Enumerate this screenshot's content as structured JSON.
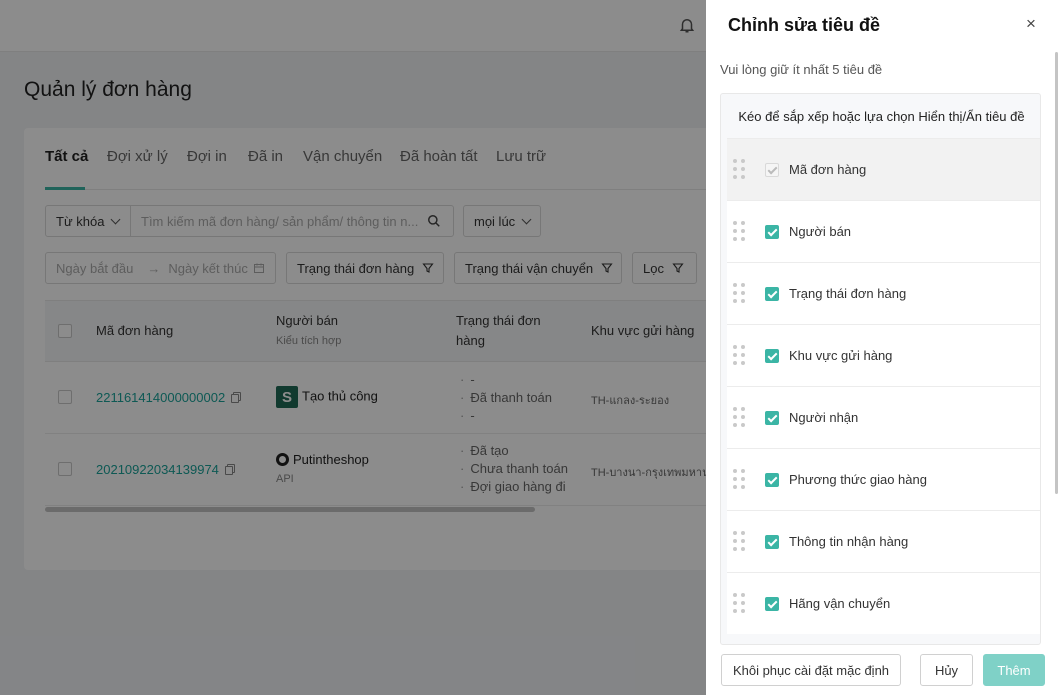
{
  "page": {
    "title": "Quản lý đơn hàng",
    "tabs": [
      "Tất cả",
      "Đợi xử lý",
      "Đợi in",
      "Đã in",
      "Vận chuyển",
      "Đã hoàn tất",
      "Lưu trữ"
    ],
    "active_tab": "Tất cả",
    "filters": {
      "keyword_select": "Từ khóa",
      "search_placeholder": "Tìm kiếm mã đơn hàng/ sản phẩm/ thông tin n...",
      "time_select": "mọi lúc",
      "start_date_placeholder": "Ngày bắt đầu",
      "arrow": "→",
      "end_date_placeholder": "Ngày kết thúc",
      "order_status": "Trạng thái đơn hàng",
      "shipping_status": "Trạng thái vận chuyển",
      "filter": "Lọc"
    },
    "table": {
      "headers": {
        "order_id": "Mã đơn hàng",
        "seller": "Người bán",
        "seller_sub": "Kiểu tích hợp",
        "order_status_l1": "Trạng thái đơn",
        "order_status_l2": "hàng",
        "region": "Khu vực gửi hàng"
      },
      "rows": [
        {
          "order_id": "221161414000000002",
          "seller_badge": "S",
          "seller": "Tạo thủ công",
          "seller_sub": "",
          "statuses": [
            "-",
            "Đã thanh toán",
            "-"
          ],
          "region": "TH-แกลง-ระยอง"
        },
        {
          "order_id": "20210922034139974",
          "seller_badge": "",
          "seller": "Putintheshop",
          "seller_sub": "API",
          "statuses": [
            "Đã tạo",
            "Chưa thanh toán",
            "Đợi giao hàng đi"
          ],
          "region": "TH-บางนา-กรุงเทพมหานคร"
        }
      ]
    }
  },
  "drawer": {
    "title": "Chỉnh sửa tiêu đề",
    "hint": "Vui lòng giữ ít nhất 5 tiêu đề",
    "panel_header": "Kéo để sắp xếp hoặc lựa chọn Hiển thị/Ẩn tiêu đề",
    "columns": [
      {
        "label": "Mã đơn hàng",
        "checked": true,
        "locked": true
      },
      {
        "label": "Người bán",
        "checked": true,
        "locked": false
      },
      {
        "label": "Trạng thái đơn hàng",
        "checked": true,
        "locked": false
      },
      {
        "label": "Khu vực gửi hàng",
        "checked": true,
        "locked": false
      },
      {
        "label": "Người nhận",
        "checked": true,
        "locked": false
      },
      {
        "label": "Phương thức giao hàng",
        "checked": true,
        "locked": false
      },
      {
        "label": "Thông tin nhận hàng",
        "checked": true,
        "locked": false
      },
      {
        "label": "Hãng vận chuyển",
        "checked": true,
        "locked": false
      }
    ],
    "buttons": {
      "reset": "Khôi phục cài đặt mặc định",
      "cancel": "Hủy",
      "add": "Thêm"
    }
  },
  "colors": {
    "accent": "#3bb5a5",
    "link": "#1aa39a",
    "primary_button": "#7fd1c7"
  },
  "icons": [
    "bell-icon",
    "close-icon",
    "search-icon",
    "calendar-icon",
    "funnel-icon",
    "copy-icon",
    "drag-handle-icon",
    "checkbox-icon"
  ]
}
